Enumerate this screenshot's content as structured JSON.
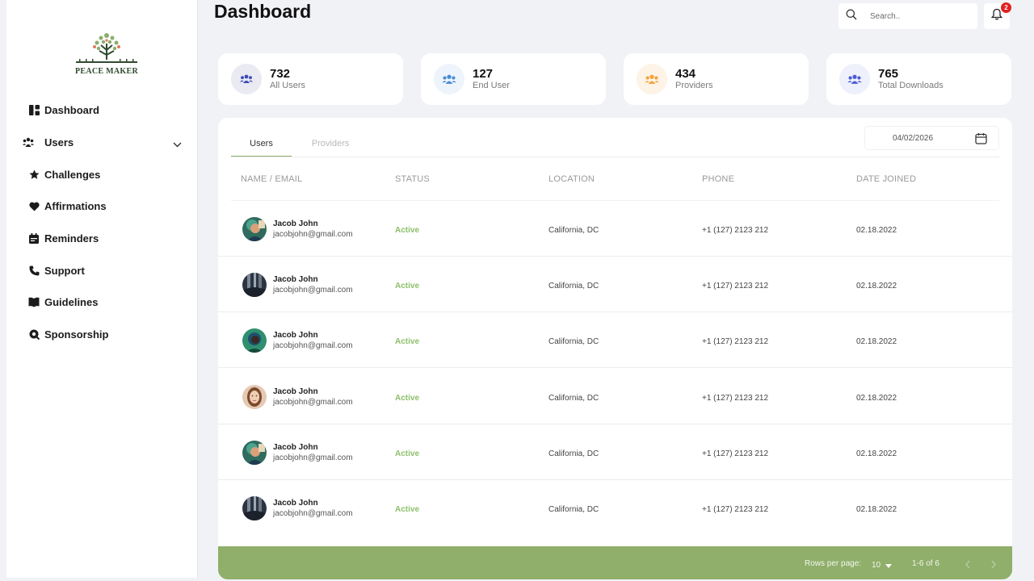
{
  "brand": {
    "name": "PEACE MAKER",
    "accent": "#8faf6a"
  },
  "sidebar": {
    "items": [
      {
        "label": "Dashboard",
        "icon": "dashboard-icon"
      },
      {
        "label": "Users",
        "icon": "users-icon"
      },
      {
        "label": "Challenges",
        "icon": "star-icon"
      },
      {
        "label": "Affirmations",
        "icon": "heart-icon"
      },
      {
        "label": "Reminders",
        "icon": "calendar-icon"
      },
      {
        "label": "Support",
        "icon": "phone-icon"
      },
      {
        "label": "Guidelines",
        "icon": "book-icon"
      },
      {
        "label": "Sponsorship",
        "icon": "badge-icon"
      }
    ]
  },
  "header": {
    "title": "Dashboard",
    "search_placeholder": "Search..",
    "notifications_count": "2"
  },
  "stats": [
    {
      "value": "732",
      "label": "All Users",
      "color": "#4a5bd6",
      "bg": "#e9eaf2"
    },
    {
      "value": "127",
      "label": "End User",
      "color": "#4a8bd6",
      "bg": "#eef4fb"
    },
    {
      "value": "434",
      "label": "Providers",
      "color": "#f5a23c",
      "bg": "#fdf3e6"
    },
    {
      "value": "765",
      "label": "Total Downloads",
      "color": "#4a5bd6",
      "bg": "#eef0fb"
    }
  ],
  "tabs": {
    "users": "Users",
    "providers": "Providers"
  },
  "date_filter": "04/02/2026",
  "table": {
    "headers": [
      "NAME / EMAIL",
      "STATUS",
      "LOCATION",
      "PHONE",
      "DATE JOINED"
    ],
    "rows": [
      {
        "name": "Jacob John",
        "email": "jacobjohn@gmail.com",
        "status": "Active",
        "location": "California, DC",
        "phone": "+1 (127) 2123 212",
        "date": "02.18.2022",
        "avatar": "a"
      },
      {
        "name": "Jacob John",
        "email": "jacobjohn@gmail.com",
        "status": "Active",
        "location": "California, DC",
        "phone": "+1 (127) 2123 212",
        "date": "02.18.2022",
        "avatar": "b"
      },
      {
        "name": "Jacob John",
        "email": "jacobjohn@gmail.com",
        "status": "Active",
        "location": "California, DC",
        "phone": "+1 (127) 2123 212",
        "date": "02.18.2022",
        "avatar": "c"
      },
      {
        "name": "Jacob John",
        "email": "jacobjohn@gmail.com",
        "status": "Active",
        "location": "California, DC",
        "phone": "+1 (127) 2123 212",
        "date": "02.18.2022",
        "avatar": "d"
      },
      {
        "name": "Jacob John",
        "email": "jacobjohn@gmail.com",
        "status": "Active",
        "location": "California, DC",
        "phone": "+1 (127) 2123 212",
        "date": "02.18.2022",
        "avatar": "a"
      },
      {
        "name": "Jacob John",
        "email": "jacobjohn@gmail.com",
        "status": "Active",
        "location": "California, DC",
        "phone": "+1 (127) 2123 212",
        "date": "02.18.2022",
        "avatar": "b"
      }
    ]
  },
  "pagination": {
    "rows_per_page_label": "Rows per page:",
    "rows_per_page": "10",
    "range": "1-6 of 6"
  }
}
